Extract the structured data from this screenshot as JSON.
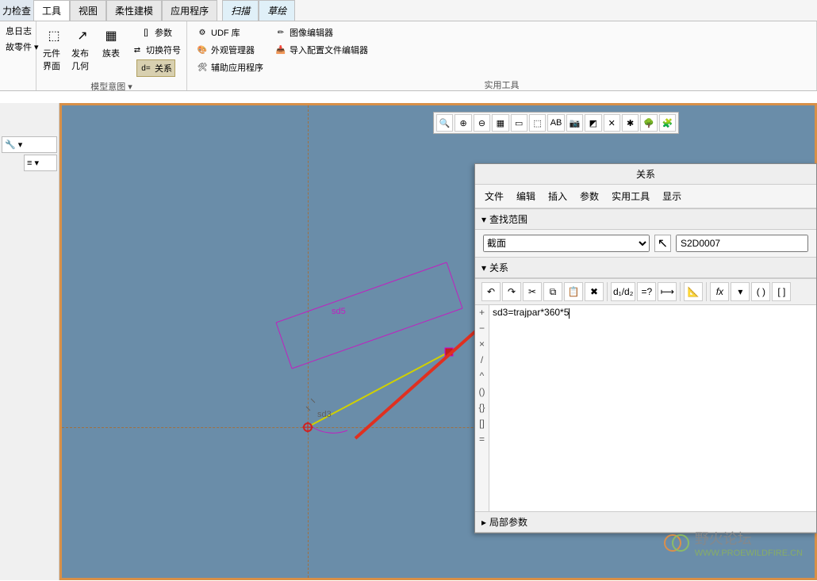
{
  "tabs": [
    "力检查",
    "工具",
    "视图",
    "柔性建模",
    "应用程序"
  ],
  "tabs_highlight": [
    "扫描",
    "草绘"
  ],
  "ribbon": {
    "group1_items": [
      "息日志",
      "故零件"
    ],
    "group2_labels": [
      "元件界面",
      "发布几何",
      "族表"
    ],
    "group2_label": "模型意图",
    "group3": {
      "param": "参数",
      "switch": "切换符号",
      "rel": "关系",
      "rel_prefix": "d="
    },
    "group4": {
      "udf": "UDF 库",
      "appearance": "外观管理器",
      "aux": "辅助应用程序"
    },
    "group5": {
      "image": "图像编辑器",
      "import": "导入配置文件编辑器"
    },
    "utility_label": "实用工具"
  },
  "relations": {
    "title": "关系",
    "menu": [
      "文件",
      "编辑",
      "插入",
      "参数",
      "实用工具",
      "显示"
    ],
    "scope_label": "查找范围",
    "scope_value": "截面",
    "scope_code": "S2D0007",
    "section_label": "关系",
    "local_params": "局部参数",
    "gutter": [
      "+",
      "−",
      "×",
      "/",
      "^",
      "()",
      "{}",
      "[]",
      "="
    ],
    "tools": [
      "↶",
      "↷",
      "✂",
      "⧉",
      "📋",
      "✖",
      "|",
      "d₁/d₂",
      "=?",
      "⟼",
      "|",
      "📐",
      "|",
      "fx",
      "▾",
      "( )",
      "[ ]"
    ],
    "expression": "sd3=trajpar*360*5"
  },
  "sketch": {
    "dim1": "sd5",
    "dim2": "sd3"
  },
  "watermark": {
    "text": "野火论坛",
    "url": "WWW.PROEWILDFIRE.CN"
  },
  "toolbar_icons": [
    "🔍",
    "⊕",
    "⊖",
    "▦",
    "▭",
    "⬚",
    "AB",
    "📷",
    "◩",
    "✕",
    "✱",
    "🌳",
    "🧩"
  ]
}
